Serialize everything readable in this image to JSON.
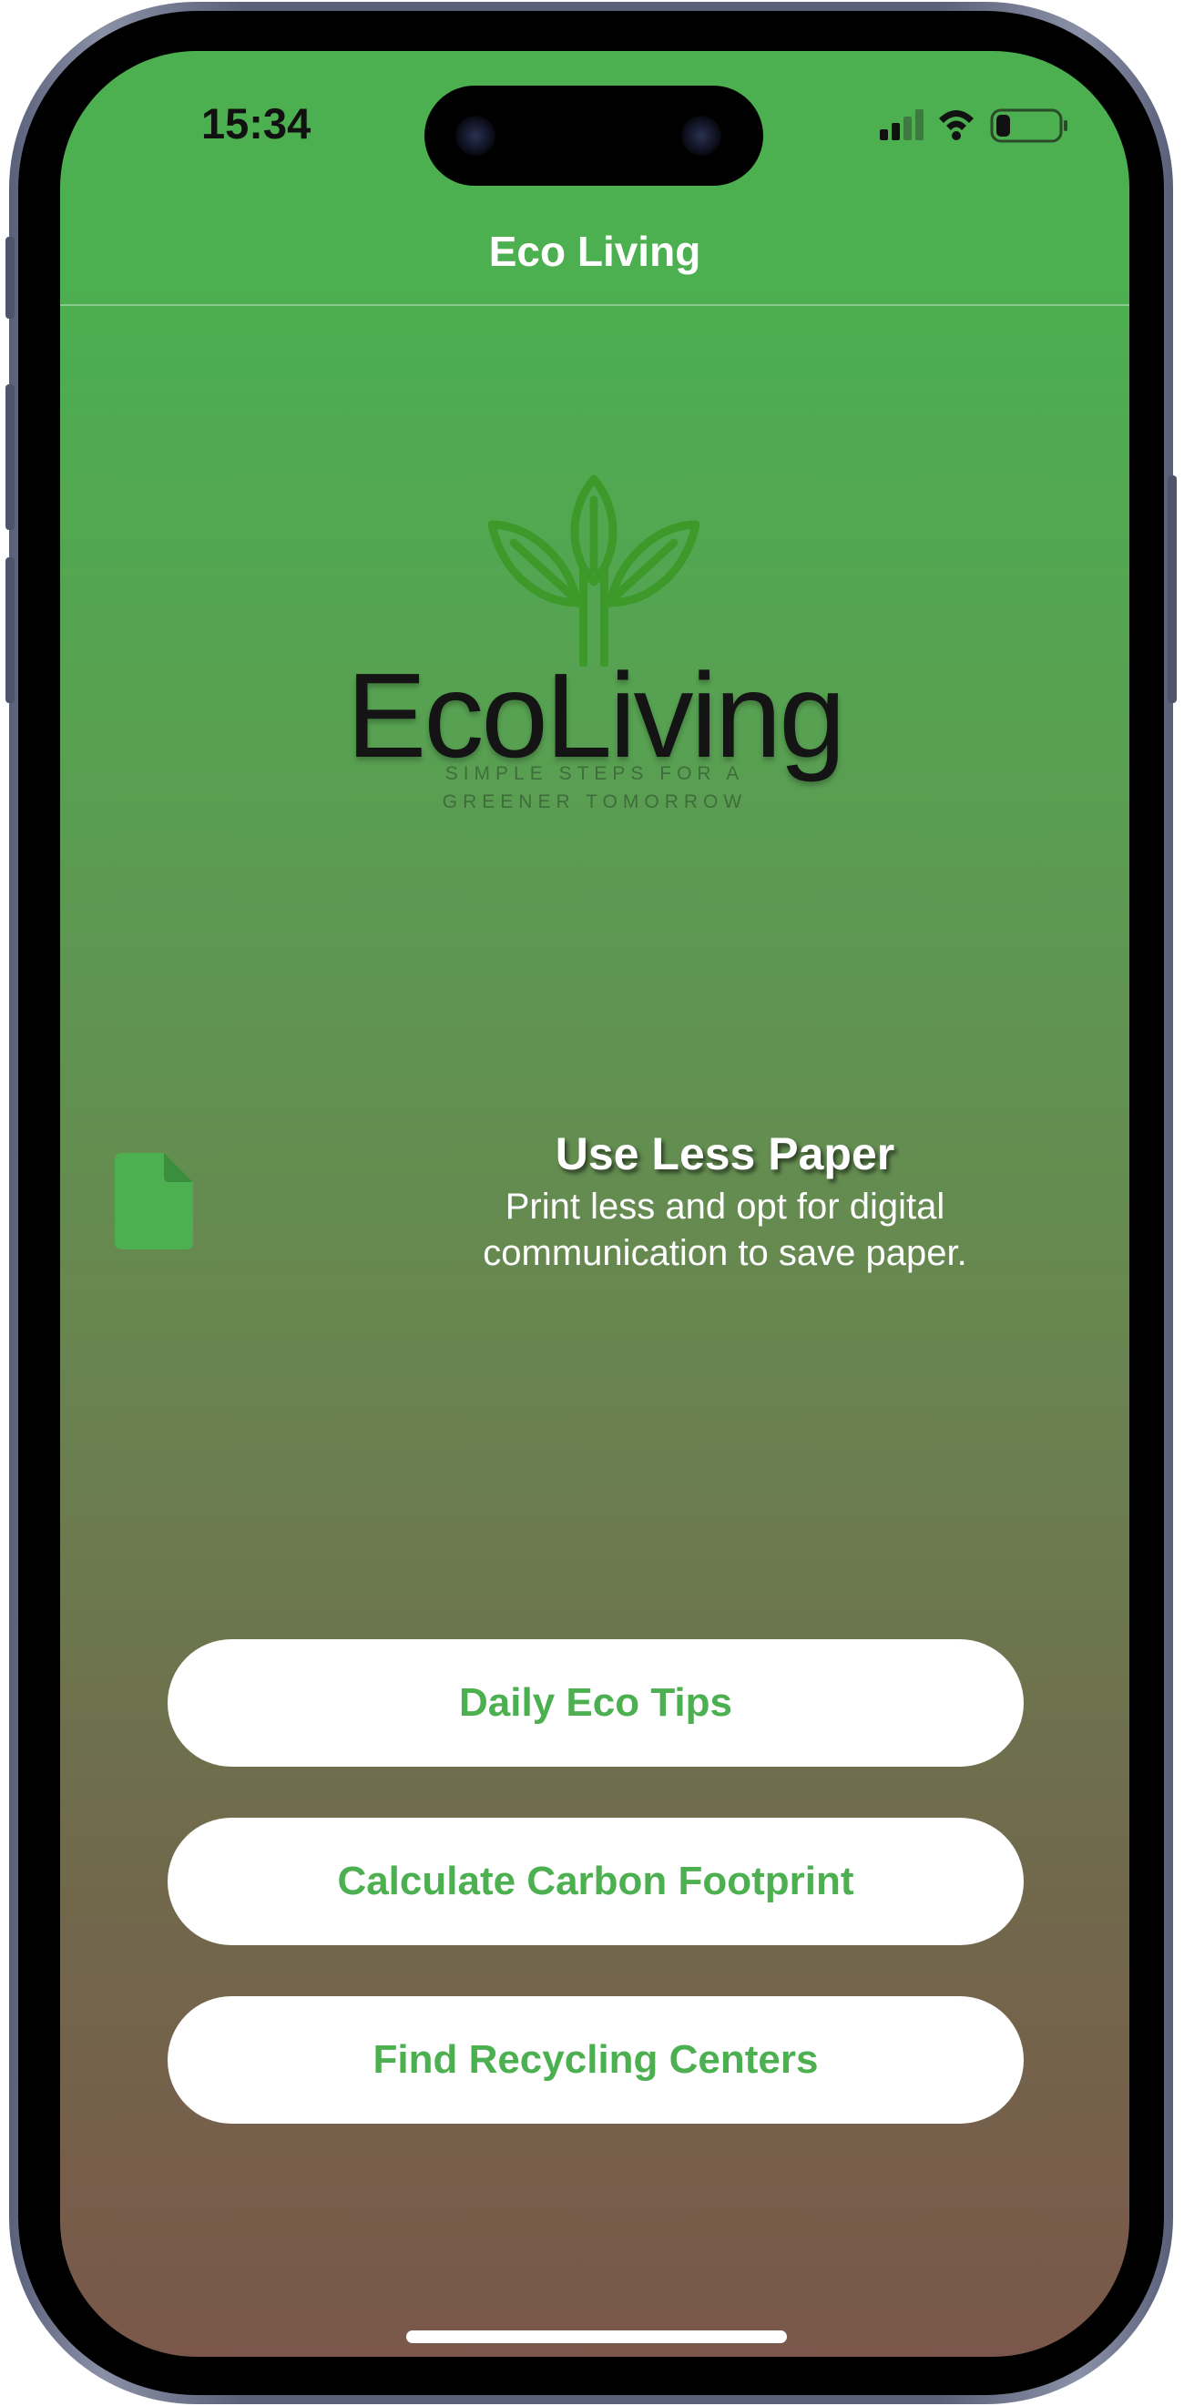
{
  "status_bar": {
    "time": "15:34",
    "icons": [
      "cellular-signal-icon",
      "wifi-icon",
      "battery-icon"
    ],
    "battery_level": 0.2
  },
  "nav": {
    "title": "Eco Living"
  },
  "logo": {
    "wordmark": "EcoLiving",
    "tagline": "SIMPLE STEPS FOR A GREENER TOMORROW"
  },
  "tip": {
    "icon": "document-icon",
    "title": "Use Less Paper",
    "body": "Print less and opt for digital communication to save paper."
  },
  "actions": [
    {
      "label": "Daily Eco Tips"
    },
    {
      "label": "Calculate Carbon Footprint"
    },
    {
      "label": "Find Recycling Centers"
    }
  ],
  "colors": {
    "brand_green": "#4caf50",
    "logo_green": "#3d9a2a",
    "gradient_bottom": "#7a574a",
    "button_bg": "#ffffff",
    "text_light": "#ffffff"
  }
}
